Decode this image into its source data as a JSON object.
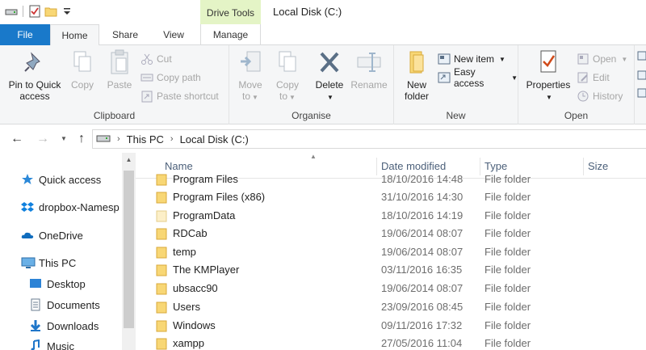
{
  "window": {
    "title": "Local Disk (C:)",
    "context_tab": "Drive Tools"
  },
  "tabs": {
    "file": "File",
    "home": "Home",
    "share": "Share",
    "view": "View",
    "manage": "Manage"
  },
  "ribbon": {
    "clipboard": {
      "label": "Clipboard",
      "pin_line1": "Pin to Quick",
      "pin_line2": "access",
      "copy": "Copy",
      "paste": "Paste",
      "cut": "Cut",
      "copy_path": "Copy path",
      "paste_shortcut": "Paste shortcut"
    },
    "organise": {
      "label": "Organise",
      "move_line1": "Move",
      "move_line2": "to",
      "copy_line1": "Copy",
      "copy_line2": "to",
      "delete": "Delete",
      "rename": "Rename"
    },
    "new": {
      "label": "New",
      "folder_line1": "New",
      "folder_line2": "folder",
      "new_item": "New item",
      "easy_access": "Easy access"
    },
    "open": {
      "label": "Open",
      "properties": "Properties",
      "open": "Open",
      "edit": "Edit",
      "history": "History"
    }
  },
  "address": {
    "crumbs": [
      "This PC",
      "Local Disk (C:)"
    ]
  },
  "navpane": {
    "items": [
      {
        "label": "Quick access",
        "icon": "star-icon"
      },
      {
        "label": "dropbox-Namesp",
        "icon": "dropbox-icon"
      },
      {
        "label": "OneDrive",
        "icon": "cloud-icon"
      },
      {
        "label": "This PC",
        "icon": "computer-icon"
      },
      {
        "label": "Desktop",
        "icon": "desktop-icon"
      },
      {
        "label": "Documents",
        "icon": "documents-icon"
      },
      {
        "label": "Downloads",
        "icon": "downloads-icon"
      },
      {
        "label": "Music",
        "icon": "music-icon"
      }
    ]
  },
  "filelist": {
    "columns": {
      "name": "Name",
      "date": "Date modified",
      "type": "Type",
      "size": "Size"
    },
    "rows": [
      {
        "name": "Program Files",
        "date": "18/10/2016 14:48",
        "type": "File folder"
      },
      {
        "name": "Program Files (x86)",
        "date": "31/10/2016 14:30",
        "type": "File folder"
      },
      {
        "name": "ProgramData",
        "date": "18/10/2016 14:19",
        "type": "File folder"
      },
      {
        "name": "RDCab",
        "date": "19/06/2014 08:07",
        "type": "File folder"
      },
      {
        "name": "temp",
        "date": "19/06/2014 08:07",
        "type": "File folder"
      },
      {
        "name": "The KMPlayer",
        "date": "03/11/2016 16:35",
        "type": "File folder"
      },
      {
        "name": "ubsacc90",
        "date": "19/06/2014 08:07",
        "type": "File folder"
      },
      {
        "name": "Users",
        "date": "23/09/2016 08:45",
        "type": "File folder"
      },
      {
        "name": "Windows",
        "date": "09/11/2016 17:32",
        "type": "File folder"
      },
      {
        "name": "xampp",
        "date": "27/05/2016 11:04",
        "type": "File folder"
      }
    ]
  },
  "colors": {
    "accent": "#1979ca",
    "drive_tools": "#e4f4c6",
    "ribbon_bg": "#f5f6f7",
    "folder": "#f8d775"
  }
}
